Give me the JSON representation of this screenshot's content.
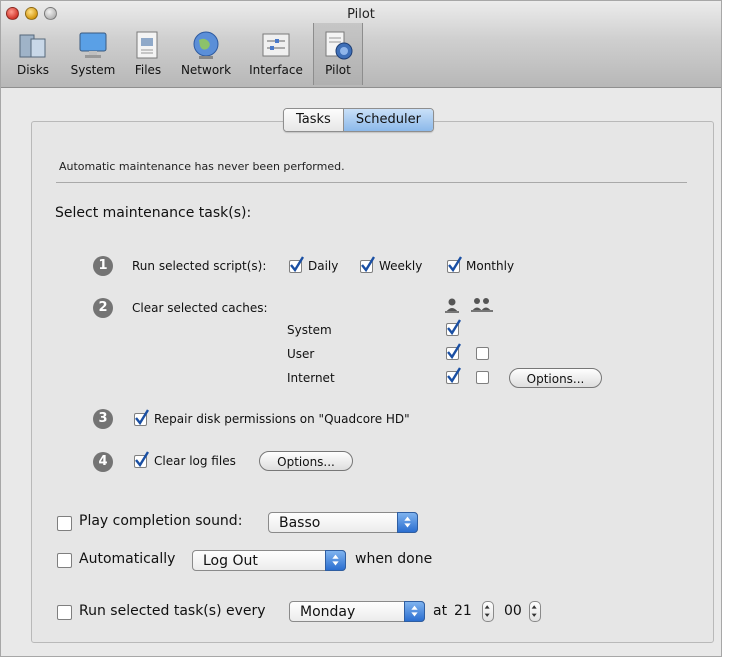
{
  "window": {
    "title": "Pilot",
    "toolbar": [
      {
        "label": "Disks",
        "icon": "disks-icon"
      },
      {
        "label": "System",
        "icon": "monitor-icon"
      },
      {
        "label": "Files",
        "icon": "files-icon"
      },
      {
        "label": "Network",
        "icon": "globe-icon"
      },
      {
        "label": "Interface",
        "icon": "interface-icon"
      },
      {
        "label": "Pilot",
        "icon": "pilot-icon",
        "selected": true
      }
    ]
  },
  "tabs": {
    "tasks": "Tasks",
    "scheduler": "Scheduler",
    "selected": "Scheduler"
  },
  "status_message": "Automatic maintenance has never been performed.",
  "heading": "Select maintenance task(s):",
  "task1": {
    "number": "1",
    "label": "Run selected script(s):",
    "daily": {
      "label": "Daily",
      "checked": true
    },
    "weekly": {
      "label": "Weekly",
      "checked": true
    },
    "monthly": {
      "label": "Monthly",
      "checked": true
    }
  },
  "task2": {
    "number": "2",
    "label": "Clear selected caches:",
    "columns": [
      "user-icon",
      "users-group-icon"
    ],
    "rows": [
      {
        "label": "System",
        "user": true,
        "all_users": null
      },
      {
        "label": "User",
        "user": true,
        "all_users": false
      },
      {
        "label": "Internet",
        "user": true,
        "all_users": false
      }
    ],
    "options_label": "Options..."
  },
  "task3": {
    "number": "3",
    "label": "Repair disk permissions on \"Quadcore HD\"",
    "checked": true
  },
  "task4": {
    "number": "4",
    "label": "Clear log files",
    "checked": true,
    "options_label": "Options..."
  },
  "sound": {
    "label": "Play completion sound:",
    "checked": false,
    "value": "Basso"
  },
  "auto": {
    "label": "Automatically",
    "checked": false,
    "value": "Log Out",
    "suffix": "when done"
  },
  "schedule": {
    "label": "Run selected task(s) every",
    "checked": false,
    "day": "Monday",
    "at_label": "at",
    "hour": "21",
    "minute": "00"
  },
  "colors": {
    "accent": "#2b6ed0",
    "check": "#1a4fa3"
  }
}
